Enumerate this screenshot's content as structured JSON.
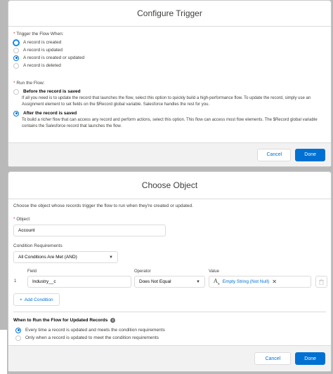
{
  "trigger_modal": {
    "title": "Configure Trigger",
    "trigger_label": "Trigger the Flow When:",
    "trigger_options": [
      "A record is created",
      "A record is updated",
      "A record is created or updated",
      "A record is deleted"
    ],
    "run_label": "Run the Flow:",
    "run_options": [
      {
        "label": "Before the record is saved",
        "description": "If all you need is to update the record that launches the flow, select this option to quickly build a high-performance flow. To update the record, simply use an Assignment element to set fields on the $Record global variable. Salesforce handles the rest for you."
      },
      {
        "label": "After the record is saved",
        "description": "To build a richer flow that can access any record and perform actions, select this option. This flow can access most flow elements. The $Record global variable contains the Salesforce record that launches the flow."
      }
    ],
    "cancel_label": "Cancel",
    "done_label": "Done"
  },
  "object_modal": {
    "title": "Choose Object",
    "intro": "Choose the object whose records trigger the flow to run when they're created or updated.",
    "object_label": "Object",
    "object_value": "Account",
    "condition_label": "Condition Requirements",
    "condition_value": "All Conditions Are Met (AND)",
    "field_header": "Field",
    "operator_header": "Operator",
    "value_header": "Value",
    "row": {
      "field": "Industry__c",
      "operator": "Does Not Equal",
      "value": "Empty String (Not Null)"
    },
    "add_condition": "Add Condition",
    "when_label": "When to Run the Flow for Updated Records",
    "when_options": [
      "Every time a record is updated and meets the condition requirements",
      "Only when a record is updated to meet the condition requirements"
    ],
    "cancel_label": "Cancel",
    "done_label": "Done"
  },
  "colors": {
    "brand": "#0070d2",
    "required": "#c23934",
    "border": "#dddbda"
  }
}
